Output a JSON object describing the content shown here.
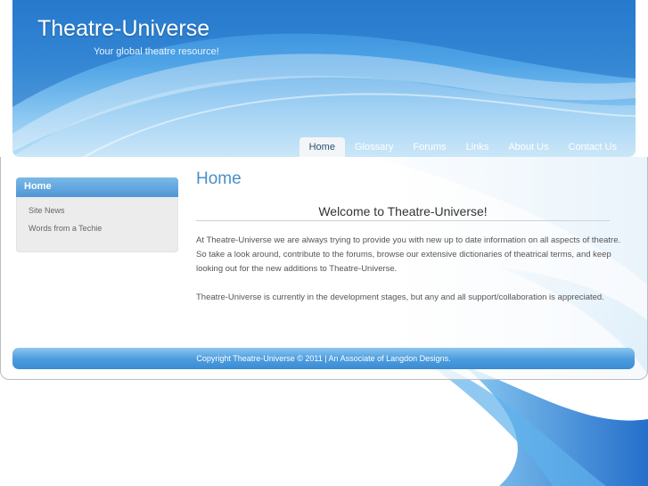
{
  "header": {
    "title": "Theatre-Universe",
    "tagline": "Your global theatre resource!"
  },
  "nav": {
    "items": [
      {
        "label": "Home"
      },
      {
        "label": "Glossary"
      },
      {
        "label": "Forums"
      },
      {
        "label": "Links"
      },
      {
        "label": "About Us"
      },
      {
        "label": "Contact Us"
      }
    ],
    "active": "Home"
  },
  "sidebar": {
    "heading": "Home",
    "links": [
      {
        "label": "Site News"
      },
      {
        "label": "Words from a Techie"
      }
    ]
  },
  "main": {
    "heading": "Home",
    "welcome": "Welcome to Theatre-Universe!",
    "paragraph1": "At Theatre-Universe we are always trying to provide you with new up to date information on all aspects of theatre.  So take a look around, contribute to the forums, browse our extensive dictionaries of theatrical terms, and keep looking out for the new additions to Theatre-Universe.",
    "paragraph2": "Theatre-Universe is currently in the development stages, but any and all support/collaboration is appreciated."
  },
  "footer": {
    "text": "Copyright Theatre-Universe © 2011 | An Associate of Langdon Designs."
  },
  "colors": {
    "accent": "#4a8fc7",
    "header_blue": "#2f86d6",
    "footer_blue": "#4e9ee0"
  }
}
